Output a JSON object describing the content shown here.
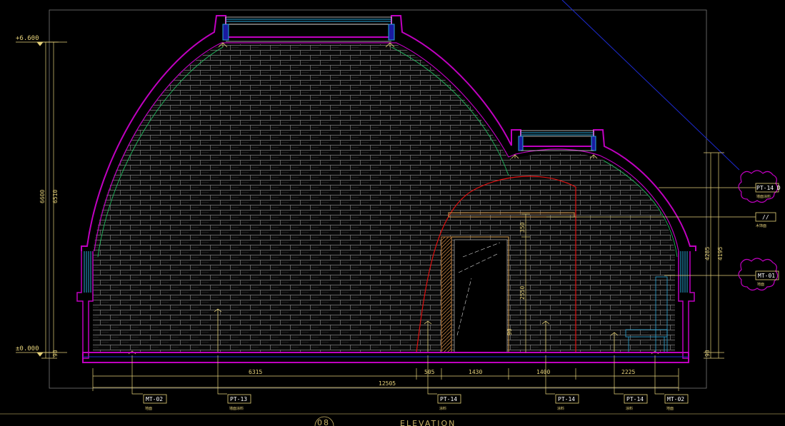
{
  "levels": {
    "top": "+6.600",
    "ground": "±0.000"
  },
  "vertical_dims": {
    "left_total": "6600",
    "left_inner": "6510",
    "left_small": "90",
    "right_total": "4285",
    "right_inner": "4195",
    "right_small": "90",
    "door_upper": "350",
    "door_lower": "2550",
    "door_sill": "90"
  },
  "horizontal_dims": {
    "segments": [
      "6315",
      "505",
      "1430",
      "1400",
      "2225"
    ],
    "total": "12505"
  },
  "tags_bottom": [
    {
      "code": "MT-02",
      "note": "地面"
    },
    {
      "code": "PT-13",
      "note": "墙面涂料"
    },
    {
      "code": "PT-14",
      "note": "涂料"
    },
    {
      "code": "PT-14",
      "note": "涂料"
    },
    {
      "code": "PT-14",
      "note": "涂料"
    },
    {
      "code": "MT-02",
      "note": "地面"
    }
  ],
  "tags_right": [
    {
      "code": "PT-14 D",
      "note": "墙面涂料"
    },
    {
      "code": "//",
      "note": "木饰面"
    },
    {
      "code": "MT-01",
      "note": "地面"
    }
  ],
  "drawing_number": "08",
  "drawing_title": "ELEVATION",
  "colors": {
    "wall": "#c000c0",
    "brick": "#7e7e7e",
    "dim": "#e6d27a",
    "arch": "#e01010",
    "glass": "#2aa6d8",
    "frame": "#d8d8d8",
    "diag": "#1d2bd2"
  }
}
